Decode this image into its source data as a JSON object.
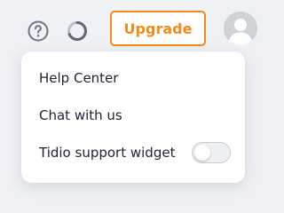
{
  "header": {
    "icons": {
      "help": "help-circle-icon",
      "progress": "progress-ring-icon"
    },
    "upgrade_label": "Upgrade",
    "avatar": "user-avatar"
  },
  "menu": {
    "items": [
      {
        "label": "Help Center"
      },
      {
        "label": "Chat with us"
      },
      {
        "label": "Tidio support widget",
        "toggle_on": false
      }
    ]
  },
  "colors": {
    "accent": "#f28b1c",
    "icon": "#6b7687",
    "text": "#1d2433"
  }
}
